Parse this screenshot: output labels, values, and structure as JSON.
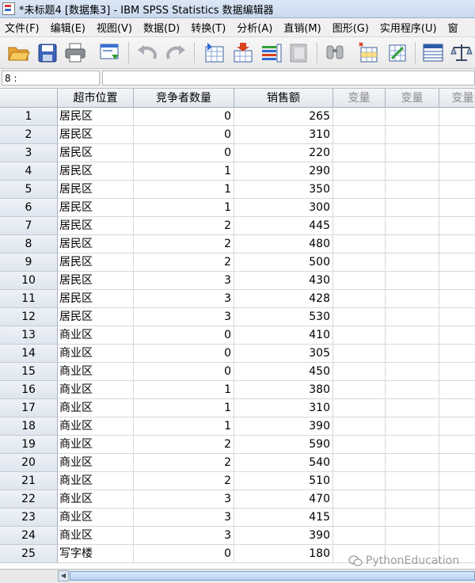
{
  "window": {
    "title": "*未标题4 [数据集3] - IBM SPSS Statistics 数据编辑器"
  },
  "menu": [
    {
      "label": "文件(F)"
    },
    {
      "label": "编辑(E)"
    },
    {
      "label": "视图(V)"
    },
    {
      "label": "数据(D)"
    },
    {
      "label": "转换(T)"
    },
    {
      "label": "分析(A)"
    },
    {
      "label": "直销(M)"
    },
    {
      "label": "图形(G)"
    },
    {
      "label": "实用程序(U)"
    },
    {
      "label": "窗"
    }
  ],
  "toolbar": {
    "buttons": [
      {
        "icon": "open-folder-icon"
      },
      {
        "icon": "save-icon"
      },
      {
        "icon": "print-icon"
      },
      {
        "icon": "recall-dialog-icon"
      },
      {
        "icon": "undo-icon"
      },
      {
        "icon": "redo-icon"
      },
      {
        "icon": "goto-case-icon"
      },
      {
        "icon": "goto-variable-icon"
      },
      {
        "icon": "variables-icon"
      },
      {
        "icon": "run-descriptives-icon"
      },
      {
        "icon": "find-icon"
      },
      {
        "icon": "insert-cases-icon"
      },
      {
        "icon": "insert-variable-icon"
      },
      {
        "icon": "split-file-icon"
      },
      {
        "icon": "weight-cases-icon"
      }
    ]
  },
  "cellbar": {
    "reference": "8 :",
    "value": ""
  },
  "grid": {
    "columns": [
      "超市位置",
      "竞争者数量",
      "销售额",
      "变量",
      "变量",
      "变量"
    ],
    "rows": [
      {
        "n": "1",
        "loc": "居民区",
        "comp": "0",
        "sales": "265"
      },
      {
        "n": "2",
        "loc": "居民区",
        "comp": "0",
        "sales": "310"
      },
      {
        "n": "3",
        "loc": "居民区",
        "comp": "0",
        "sales": "220"
      },
      {
        "n": "4",
        "loc": "居民区",
        "comp": "1",
        "sales": "290"
      },
      {
        "n": "5",
        "loc": "居民区",
        "comp": "1",
        "sales": "350"
      },
      {
        "n": "6",
        "loc": "居民区",
        "comp": "1",
        "sales": "300"
      },
      {
        "n": "7",
        "loc": "居民区",
        "comp": "2",
        "sales": "445"
      },
      {
        "n": "8",
        "loc": "居民区",
        "comp": "2",
        "sales": "480"
      },
      {
        "n": "9",
        "loc": "居民区",
        "comp": "2",
        "sales": "500"
      },
      {
        "n": "10",
        "loc": "居民区",
        "comp": "3",
        "sales": "430"
      },
      {
        "n": "11",
        "loc": "居民区",
        "comp": "3",
        "sales": "428"
      },
      {
        "n": "12",
        "loc": "居民区",
        "comp": "3",
        "sales": "530"
      },
      {
        "n": "13",
        "loc": "商业区",
        "comp": "0",
        "sales": "410"
      },
      {
        "n": "14",
        "loc": "商业区",
        "comp": "0",
        "sales": "305"
      },
      {
        "n": "15",
        "loc": "商业区",
        "comp": "0",
        "sales": "450"
      },
      {
        "n": "16",
        "loc": "商业区",
        "comp": "1",
        "sales": "380"
      },
      {
        "n": "17",
        "loc": "商业区",
        "comp": "1",
        "sales": "310"
      },
      {
        "n": "18",
        "loc": "商业区",
        "comp": "1",
        "sales": "390"
      },
      {
        "n": "19",
        "loc": "商业区",
        "comp": "2",
        "sales": "590"
      },
      {
        "n": "20",
        "loc": "商业区",
        "comp": "2",
        "sales": "540"
      },
      {
        "n": "21",
        "loc": "商业区",
        "comp": "2",
        "sales": "510"
      },
      {
        "n": "22",
        "loc": "商业区",
        "comp": "3",
        "sales": "470"
      },
      {
        "n": "23",
        "loc": "商业区",
        "comp": "3",
        "sales": "415"
      },
      {
        "n": "24",
        "loc": "商业区",
        "comp": "3",
        "sales": "390"
      },
      {
        "n": "25",
        "loc": "写字楼",
        "comp": "0",
        "sales": "180"
      }
    ]
  },
  "watermark": {
    "text": "PythonEducation"
  },
  "colors": {
    "accent": "#3a6fd2",
    "header_bg": "#e6eaf0",
    "grid_line": "#d4d8de"
  }
}
